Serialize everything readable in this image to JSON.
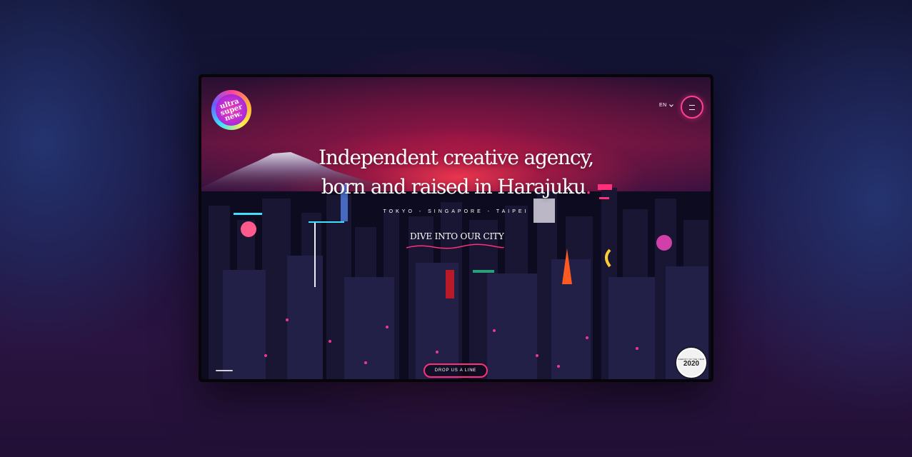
{
  "logo": {
    "lines": [
      "ultra",
      "super",
      "new."
    ]
  },
  "header": {
    "language": "EN",
    "chevron_icon": "chevron-down-icon",
    "menu_icon": "hamburger-menu-icon"
  },
  "hero": {
    "headline_line1": "Independent creative agency,",
    "headline_line2": "born and raised in Harajuku",
    "headline_dot": ".",
    "cities": "TOKYO - SINGAPORE - TAIPEI",
    "cta": "DIVE INTO OUR CITY"
  },
  "footer": {
    "contact_button": "DROP US A LINE",
    "award": {
      "small": "AGENCY OF THE YEAR",
      "year": "2020"
    }
  },
  "colors": {
    "accent": "#ff2f7a",
    "background": "#0b0a1a"
  }
}
